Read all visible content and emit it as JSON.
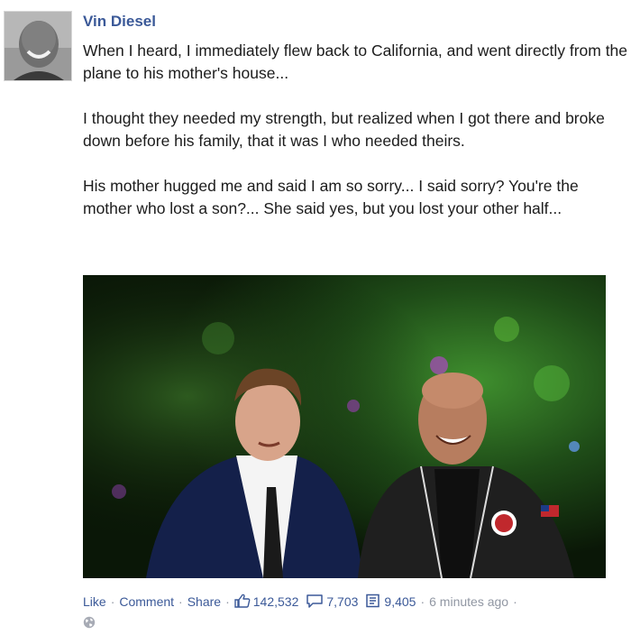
{
  "post": {
    "author": "Vin Diesel",
    "paragraphs": [
      "When I heard, I immediately flew back to California, and went directly from the plane to his mother's house...",
      "I thought they needed my strength, but realized when I got there and broke down before his family, that it was I who needed theirs.",
      "His mother hugged me and said I am so sorry... I said sorry? You're the mother who lost a son?... She said yes, but you lost your other half..."
    ]
  },
  "actions": {
    "like": "Like",
    "comment": "Comment",
    "share": "Share",
    "separator": "·",
    "likes_count": "142,532",
    "comments_count": "7,703",
    "shares_count": "9,405",
    "timestamp": "6 minutes ago"
  },
  "colors": {
    "link": "#3b5998",
    "meta": "#9197a3",
    "text": "#1c1c1c"
  },
  "icons": {
    "like": "thumbs-up-icon",
    "comment": "speech-bubble-icon",
    "share": "share-doc-icon",
    "privacy": "globe-icon"
  }
}
